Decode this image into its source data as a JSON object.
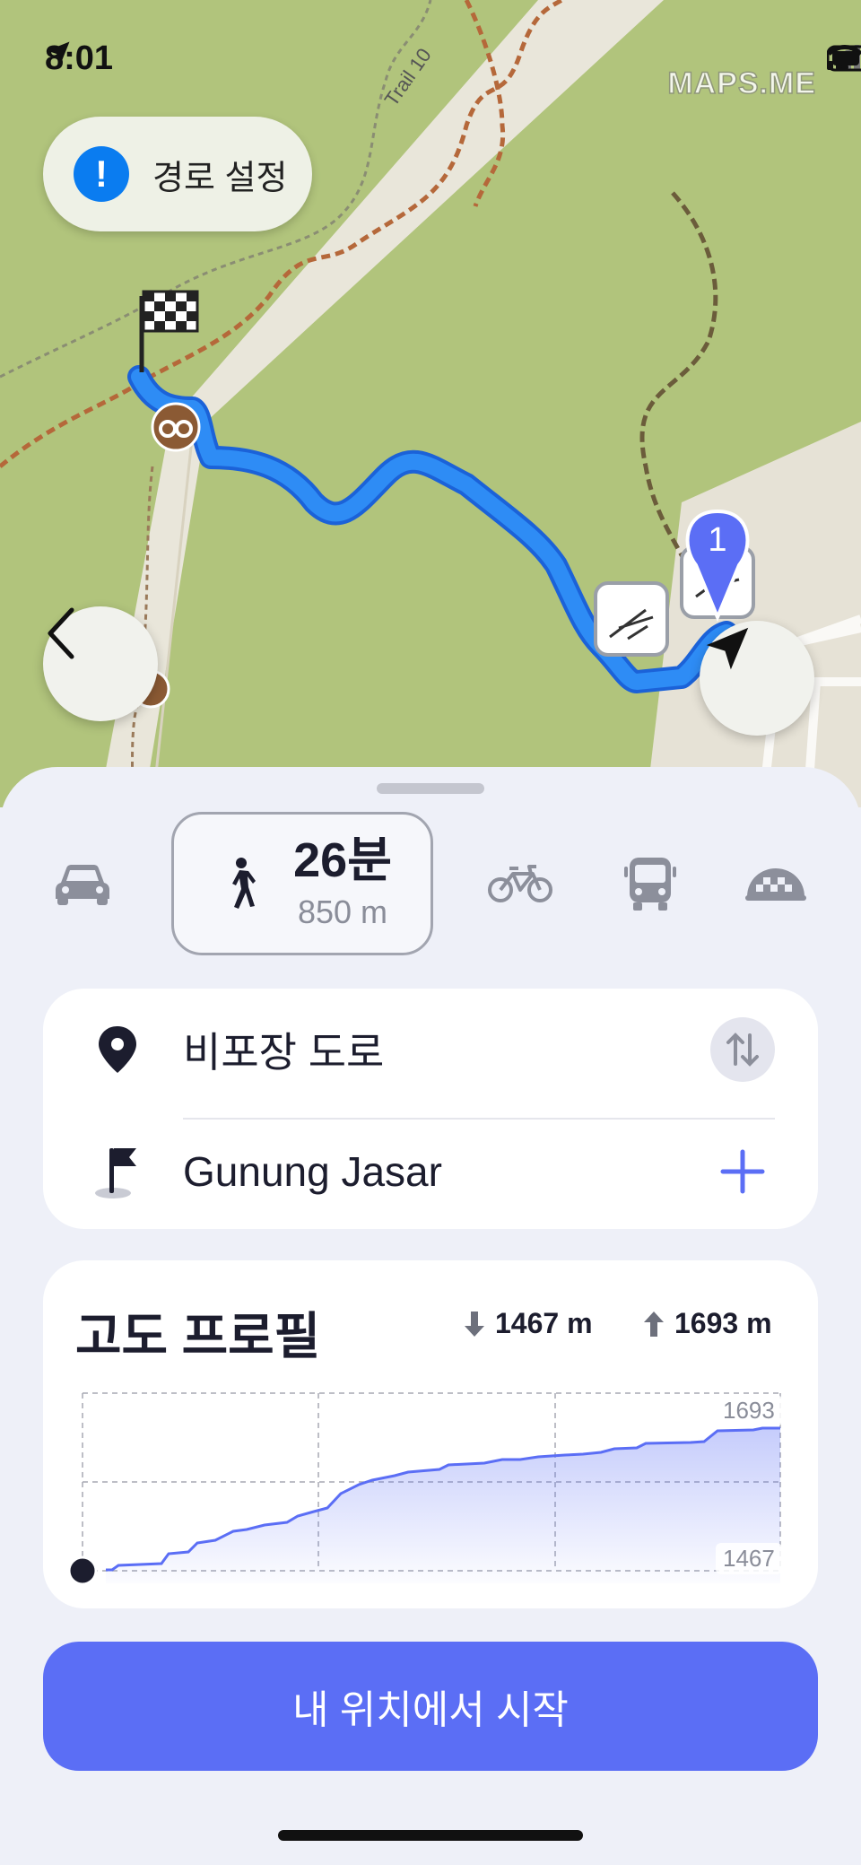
{
  "status_bar": {
    "time": "8:01",
    "location_icon": "location-arrow-icon",
    "signal_icon": "signal-icon",
    "wifi_icon": "wifi-icon",
    "battery_icon": "battery-icon"
  },
  "map": {
    "watermark": "MAPS.ME",
    "trail_label": "Trail 10",
    "route_chip": {
      "badge": "!",
      "label": "경로 설정"
    },
    "waypoint_badge": "1",
    "route_color": "#1b7ef0",
    "background_color": "#b1c47c"
  },
  "sheet": {
    "modes": [
      {
        "name": "car",
        "icon": "car-icon"
      },
      {
        "name": "walk",
        "icon": "walk-icon",
        "active": true,
        "time": "26분",
        "distance": "850 m"
      },
      {
        "name": "bike",
        "icon": "bicycle-icon"
      },
      {
        "name": "transit",
        "icon": "bus-icon"
      },
      {
        "name": "taxi",
        "icon": "taxi-icon"
      }
    ],
    "waypoints": {
      "start": {
        "label": "비포장 도로",
        "icon": "pin-icon",
        "action_icon": "swap-icon"
      },
      "finish": {
        "label": "Gunung Jasar",
        "icon": "flag-icon",
        "action_icon": "plus-icon"
      }
    },
    "elevation": {
      "title": "고도 프로필",
      "descent": "1467 m",
      "ascent": "1693 m",
      "max_label": "1693",
      "min_label": "1467"
    },
    "start_button": "내 위치에서 시작",
    "accent_color": "#5b6ef5"
  }
}
